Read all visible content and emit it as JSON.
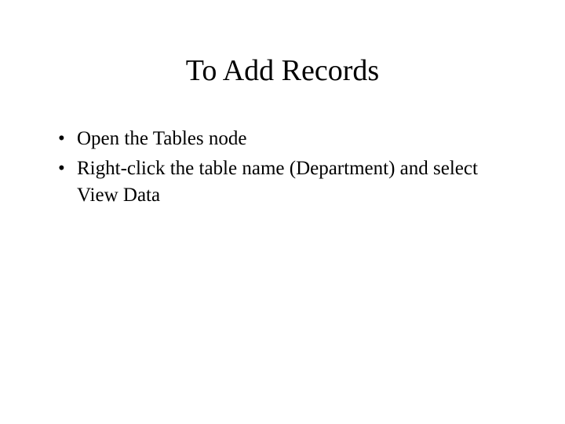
{
  "slide": {
    "title": "To Add Records",
    "bullets": [
      "Open the Tables node",
      "Right-click the table name (Department) and select View Data"
    ]
  }
}
